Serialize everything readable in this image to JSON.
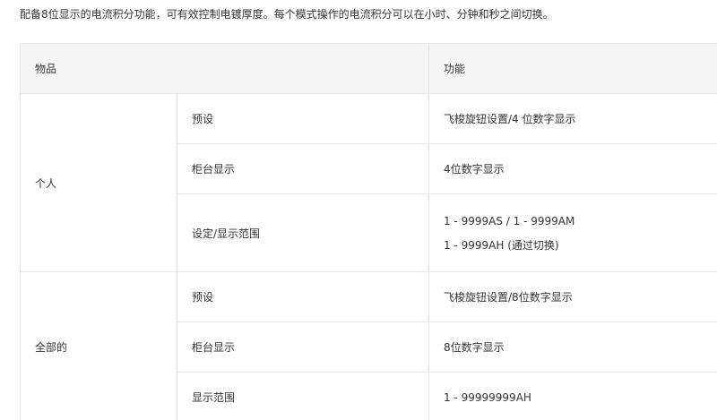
{
  "intro": "配备8位显示的电流积分功能，可有效控制电镀厚度。每个模式操作的电流积分可以在小时、分钟和秒之间切换。",
  "table": {
    "headers": {
      "item": "物品",
      "function": "功能"
    },
    "groups": [
      {
        "name": "个人",
        "rows": [
          {
            "item": "预设",
            "function": [
              "飞梭旋钮设置/4 位数字显示"
            ]
          },
          {
            "item": "柜台显示",
            "function": [
              "4位数字显示"
            ]
          },
          {
            "item": "设定/显示范围",
            "function": [
              "1 - 9999AS / 1 - 9999AM",
              "1 - 9999AH (通过切换)"
            ]
          }
        ]
      },
      {
        "name": "全部的",
        "rows": [
          {
            "item": "预设",
            "function": [
              "飞梭旋钮设置/8位数字显示"
            ]
          },
          {
            "item": "柜台显示",
            "function": [
              "8位数字显示"
            ]
          },
          {
            "item": "显示范围",
            "function": [
              "1 - 99999999AH"
            ]
          }
        ]
      }
    ]
  }
}
